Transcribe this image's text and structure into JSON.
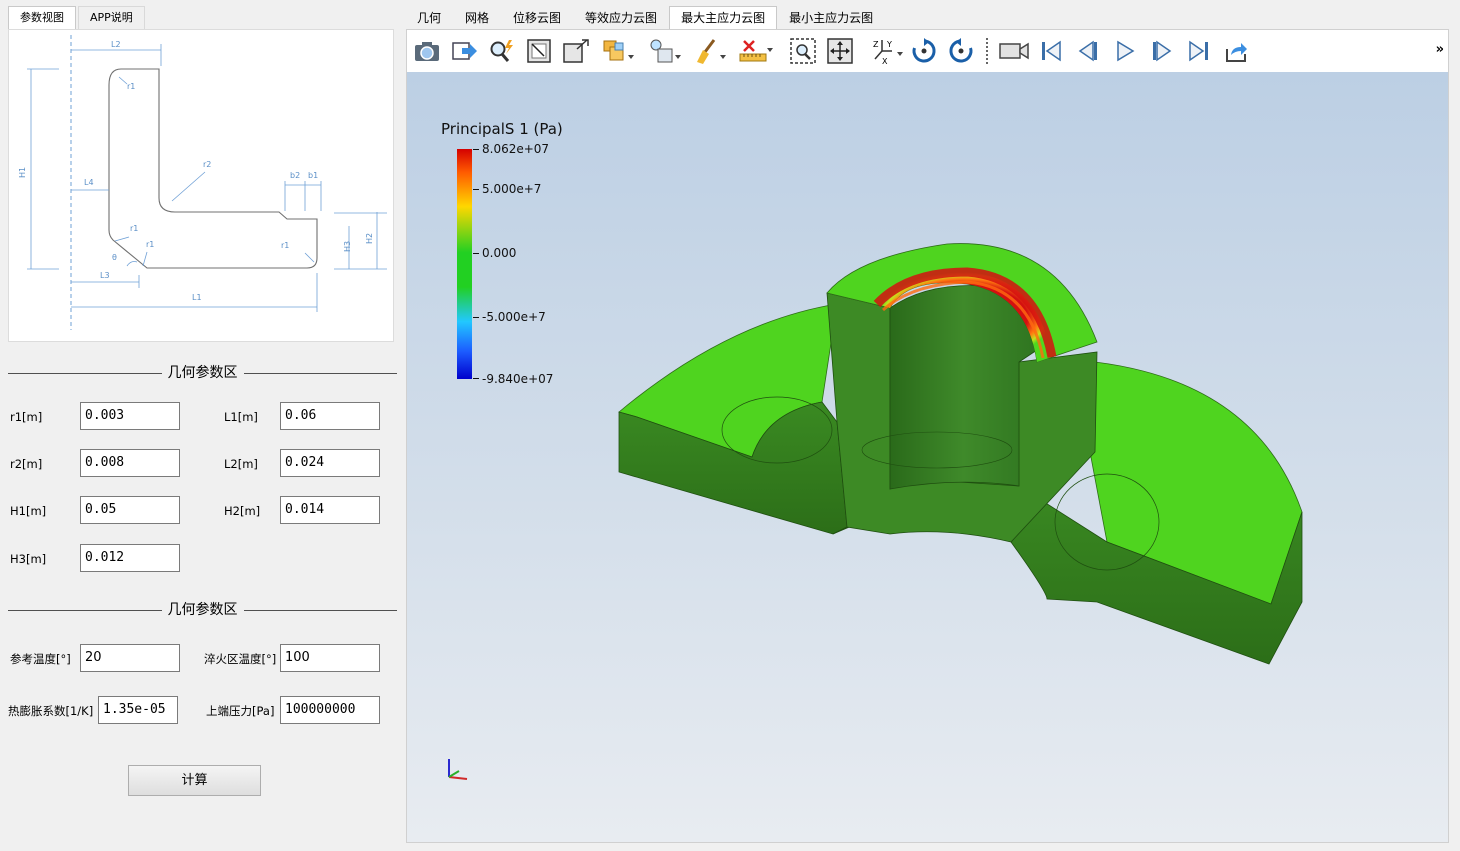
{
  "left_tabs": [
    "参数视图",
    "APP说明"
  ],
  "sketch": {
    "labels": [
      "L2",
      "r1",
      "H1",
      "r2",
      "L4",
      "b2",
      "b1",
      "r1",
      "r1",
      "r1",
      "θ",
      "H3",
      "H2",
      "L3",
      "L1"
    ]
  },
  "geometry_section": {
    "title": "几何参数区"
  },
  "geometry_params": [
    {
      "label": "r1[m]",
      "value": "0.003"
    },
    {
      "label": "L1[m]",
      "value": "0.06"
    },
    {
      "label": "r2[m]",
      "value": "0.008"
    },
    {
      "label": "L2[m]",
      "value": "0.024"
    },
    {
      "label": "H1[m]",
      "value": "0.05"
    },
    {
      "label": "H2[m]",
      "value": "0.014"
    },
    {
      "label": "H3[m]",
      "value": "0.012"
    }
  ],
  "physics_section": {
    "title": "几何参数区"
  },
  "physics_params": [
    {
      "label": "参考温度[°]",
      "value": "20"
    },
    {
      "label": "淬火区温度[°]",
      "value": "100"
    },
    {
      "label": "热膨胀系数[1/K]",
      "value": "1.35e-05"
    },
    {
      "label": "上端压力[Pa]",
      "value": "100000000"
    }
  ],
  "calc_button": "计算",
  "right_tabs": [
    "几何",
    "网格",
    "位移云图",
    "等效应力云图",
    "最大主应力云图",
    "最小主应力云图"
  ],
  "active_right_tab": "最大主应力云图",
  "toolbar": {
    "icons": [
      "camera-icon",
      "export-icon",
      "zoom-interact-icon",
      "reset-view-icon",
      "zoom-box-icon",
      "representation-icon",
      "lighting-icon",
      "color-brush-icon",
      "ruler-icon",
      "select-zoom-icon",
      "fit-all-icon",
      "axes-orient-icon",
      "rotate-cw-icon",
      "rotate-ccw-icon",
      "video-camera-icon",
      "first-frame-icon",
      "prev-frame-icon",
      "play-icon",
      "next-frame-icon",
      "last-frame-icon",
      "share-icon"
    ],
    "more": "»"
  },
  "legend": {
    "title": "PrincipalS 1 (Pa)",
    "labels": [
      "8.062e+07",
      "5.000e+7",
      "0.000",
      "-5.000e+7",
      "-9.840e+07"
    ],
    "colors": {
      "max": "#d40000",
      "mid": "#22d022",
      "min": "#0000cc"
    }
  }
}
